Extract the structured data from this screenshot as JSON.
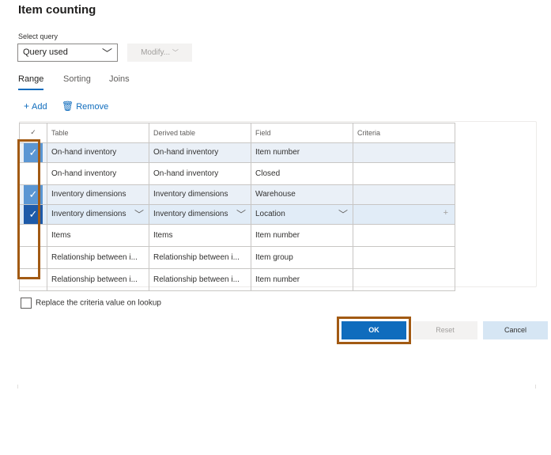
{
  "title": "Item counting",
  "query": {
    "label": "Select query",
    "value": "Query used",
    "modify_label": "Modify..."
  },
  "tabs": [
    {
      "label": "Range",
      "active": true
    },
    {
      "label": "Sorting",
      "active": false
    },
    {
      "label": "Joins",
      "active": false
    }
  ],
  "actions": {
    "add_label": "Add",
    "remove_label": "Remove"
  },
  "grid": {
    "headers": {
      "check": "✓",
      "table": "Table",
      "derived": "Derived table",
      "field": "Field",
      "criteria": "Criteria"
    },
    "rows": [
      {
        "checked": true,
        "table": "On-hand inventory",
        "derived": "On-hand inventory",
        "field": "Item number",
        "criteria": ""
      },
      {
        "checked": false,
        "table": "On-hand inventory",
        "derived": "On-hand inventory",
        "field": "Closed",
        "criteria": ""
      },
      {
        "checked": true,
        "table": "Inventory dimensions",
        "derived": "Inventory dimensions",
        "field": "Warehouse",
        "criteria": ""
      },
      {
        "checked": true,
        "table": "Inventory dimensions",
        "derived": "Inventory dimensions",
        "field": "Location",
        "criteria": ""
      },
      {
        "checked": false,
        "table": "Items",
        "derived": "Items",
        "field": "Item number",
        "criteria": ""
      },
      {
        "checked": false,
        "table": "Relationship between i...",
        "derived": "Relationship between i...",
        "field": "Item group",
        "criteria": ""
      },
      {
        "checked": false,
        "table": "Relationship between i...",
        "derived": "Relationship between i...",
        "field": "Item number",
        "criteria": ""
      }
    ]
  },
  "replace_label": "Replace the criteria value on lookup",
  "buttons": {
    "ok": "OK",
    "reset": "Reset",
    "cancel": "Cancel"
  },
  "colors": {
    "accent": "#0f6cbd",
    "highlight": "#a25a13",
    "selected_check": "#5b96d3",
    "active_check": "#1e5aa8"
  }
}
